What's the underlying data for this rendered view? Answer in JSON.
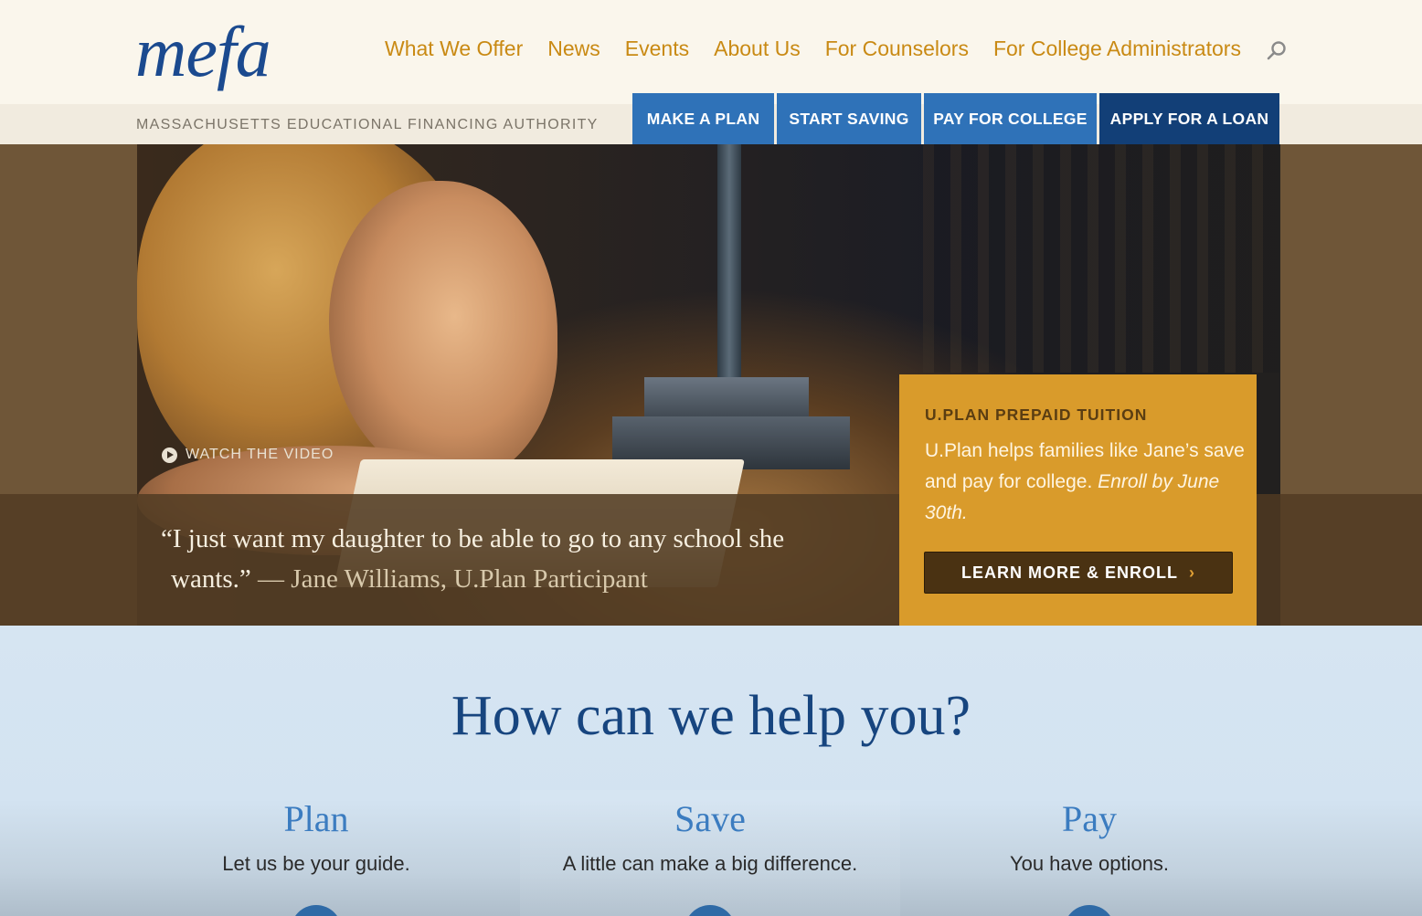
{
  "header": {
    "logo": "mefa",
    "tagline": "MASSACHUSETTS EDUCATIONAL FINANCING AUTHORITY",
    "nav": [
      "What We Offer",
      "News",
      "Events",
      "About Us",
      "For Counselors",
      "For College Administrators"
    ],
    "search_icon": "search-icon",
    "action_tabs": [
      "MAKE A PLAN",
      "START SAVING",
      "PAY FOR COLLEGE",
      "APPLY FOR A LOAN"
    ]
  },
  "hero": {
    "watch_label": "WATCH THE VIDEO",
    "quote_line1": "“I just want my daughter to be able to go to any school she",
    "quote_line2": "wants.”",
    "quote_attribution": "— Jane Williams, U.Plan Participant",
    "promo": {
      "title": "U.PLAN PREPAID TUITION",
      "body": "U.Plan helps families like Jane’s save and pay for college.",
      "body_emphasis": "Enroll by June 30th.",
      "button_label": "LEARN MORE & ENROLL",
      "button_chevron": "›"
    }
  },
  "help": {
    "title": "How can we help you?",
    "columns": [
      {
        "title": "Plan",
        "subtitle": "Let us be your guide."
      },
      {
        "title": "Save",
        "subtitle": "A little can make a big difference."
      },
      {
        "title": "Pay",
        "subtitle": "You have options."
      }
    ]
  },
  "colors": {
    "brand_blue": "#1b4a8f",
    "nav_gold": "#c98a14",
    "tab_blue": "#2f72b8",
    "tab_dark": "#123f77",
    "promo_gold": "#d99b2b"
  }
}
